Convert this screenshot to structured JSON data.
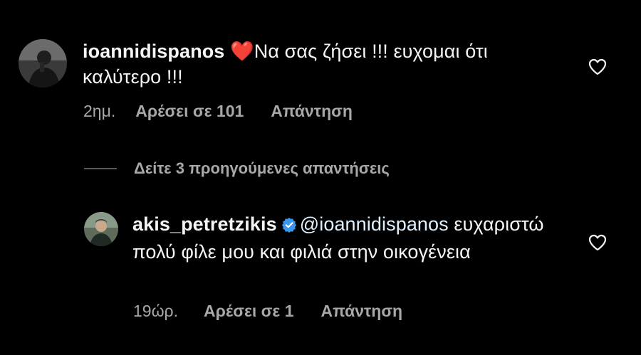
{
  "comments": [
    {
      "username": "ioannidispanos",
      "emoji": "❤️",
      "text": "Να σας ζήσει !!! ευχομαι ότι καλύτερο !!!",
      "time": "2ημ.",
      "likes": "Αρέσει σε 101",
      "reply": "Απάντηση",
      "avatar_icon": "person-avatar-icon",
      "like_icon": "heart-outline-icon"
    }
  ],
  "view_replies": {
    "label": "Δείτε 3 προηγούμενες απαντήσεις"
  },
  "replies": [
    {
      "username": "akis_petretzikis",
      "verified": true,
      "mention": "@ioannidispanos",
      "text": "ευχαριστώ πολύ φίλε μου και φιλιά στην οικογένεια",
      "time": "19ώρ.",
      "likes": "Αρέσει σε 1",
      "reply": "Απάντηση",
      "avatar_icon": "person-avatar-icon",
      "like_icon": "heart-outline-icon"
    }
  ],
  "colors": {
    "background": "#000000",
    "text": "#f5f5f5",
    "secondary": "#a8a8a8",
    "verified": "#3897f0",
    "heart_emoji": "#ff3040"
  }
}
